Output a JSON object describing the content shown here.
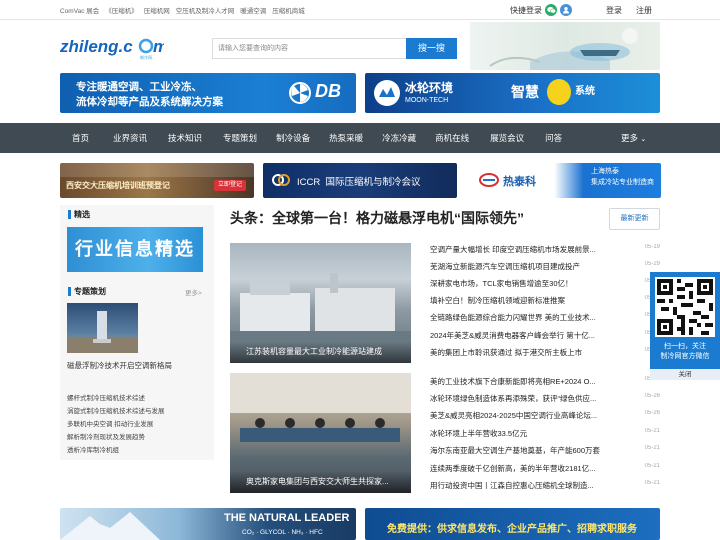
{
  "topbar": {
    "links": [
      "ComVac 展会",
      "《压缩机》",
      "压缩机网",
      "空压机及制冷人才网",
      "暖通空调",
      "压缩机商城"
    ],
    "quick_login": "快捷登录",
    "login": "登录",
    "register": "注册"
  },
  "header": {
    "logo_text": "zhileng.com",
    "logo_sub": "制冷网",
    "search_placeholder": "请输入您要查询的内容",
    "search_button": "搜一搜"
  },
  "banners": {
    "db_text_1": "专注暖通空调、工业冷冻、",
    "db_text_2": "流体冷却等产品及系统解决方案",
    "db_logo": "DB",
    "moon_cn": "冰轮环境",
    "moon_en": "MOON-TECH",
    "moon_slogan": "智慧",
    "moon_suffix": "系统",
    "xjtu_text": "西安交大压缩机培训班预登记",
    "xjtu_badge": "立即登记",
    "iccr_text": "ICCR  国际压缩机与制冷会议",
    "rtk_cn": "热泰科",
    "rtk_slogan_1": "上海热泰",
    "rtk_slogan_2": "集成冷站专业制造商",
    "natural": "THE NATURAL LEADER",
    "natural_sub": "CO₂ · GLYCOL · NH₃ · HFC",
    "free_text": "免费提供：供求信息发布、企业产品推广、招聘求职服务"
  },
  "nav": {
    "items": [
      "首页",
      "业界资讯",
      "技术知识",
      "专题策划",
      "制冷设备",
      "热泵采暖",
      "冷冻冷藏",
      "商机在线",
      "展览会议",
      "问答"
    ],
    "more": "更多"
  },
  "left": {
    "jingxuan_title": "精选",
    "jingxuan_banner": "行业信息精选",
    "zhuanti_title": "专题策划",
    "zhuanti_more": "更多>",
    "zhuanti_caption": "磁悬浮制冷技术开启空调新格局",
    "zhuanti_list": [
      "螺杆式制冷压缩机技术综述",
      "涡旋式制冷压缩机技术综述与发展",
      "多联机中央空调 扣动行业发展",
      "解析制冷剂现状及发展趋势",
      "透析冷库制冷机组"
    ]
  },
  "main": {
    "headline": "头条：全球第一台！格力磁悬浮电机“国际领先”",
    "refresh": "最新更新",
    "photo1_caption": "江苏装机容量最大工业制冷能源站建成",
    "photo2_caption": "奥克斯家电集团与西安交大师生共探家...",
    "news_top": [
      {
        "title": "空调产量大幅增长 印度空调压缩机市场发展前景...",
        "date": "05-19"
      },
      {
        "title": "芜湖海立新能源汽车空调压缩机项目建成投产",
        "date": "05-29"
      },
      {
        "title": "深耕家电市场，TCL家电销售增逾至30亿！",
        "date": "05-29"
      },
      {
        "title": "填补空白！制冷压缩机领域迎新标准推案",
        "date": "05-23"
      },
      {
        "title": "全链路绿色能源综合能力闪耀世界 美的工业技术...",
        "date": "05-23"
      },
      {
        "title": "2024年美芝&威灵消费电器客户峰会举行 第十亿...",
        "date": "05-23"
      },
      {
        "title": "美的集团上市聆讯获通过 拟于港交所主板上市",
        "date": "05-22"
      }
    ],
    "news_bottom": [
      {
        "title": "美的工业技术旗下合康新能即将亮相RE+2024 O...",
        "date": "05-30"
      },
      {
        "title": "冰轮环境绿色制造体系再添殊荣，获评“绿色供应...",
        "date": "05-26"
      },
      {
        "title": "美芝&威灵亮相2024-2025中国空调行业高峰论坛...",
        "date": "05-26"
      },
      {
        "title": "冰轮环境上半年营收33.5亿元",
        "date": "05-21"
      },
      {
        "title": "海尔东南亚最大空调生产基地奠基，年产能600万套",
        "date": "05-21"
      },
      {
        "title": "连续两季度破千亿创新高，美的半年营收2181亿...",
        "date": "05-21"
      },
      {
        "title": "用行动投资中国丨江森自控惠心压缩机全球制造...",
        "date": "05-21"
      }
    ]
  },
  "qr": {
    "text_1": "扫一扫，关注",
    "text_2": "制冷网官方微信",
    "close": "关闭"
  },
  "colors": {
    "accent": "#1a7bd1",
    "nav_bg": "#3f4a52",
    "wechat": "#2aae67"
  }
}
